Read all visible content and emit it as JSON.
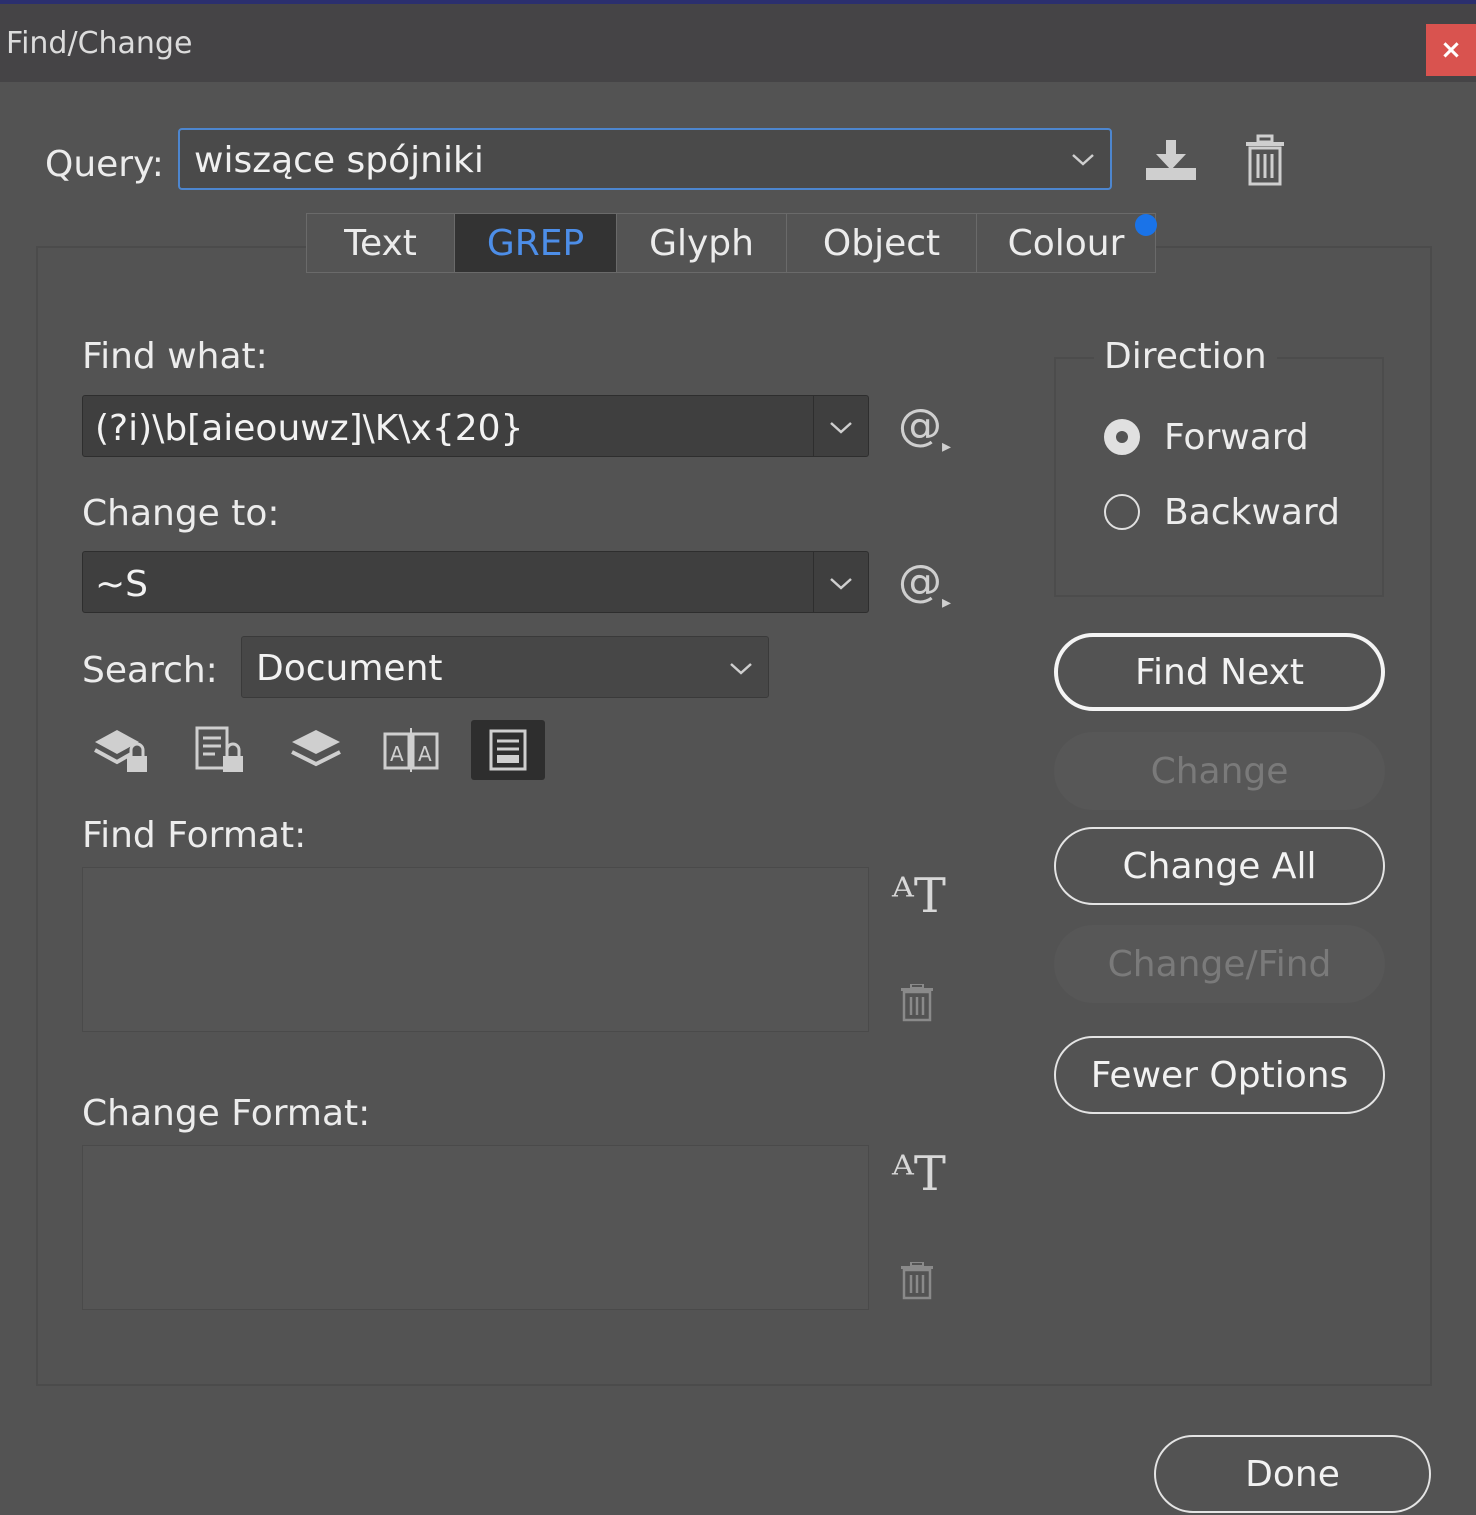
{
  "window": {
    "title": "Find/Change",
    "close_glyph": "×"
  },
  "query": {
    "label": "Query:",
    "value": "wiszące spójniki",
    "save_icon": "save-query-icon",
    "delete_icon": "delete-query-icon"
  },
  "tabs": [
    {
      "label": "Text",
      "active": false
    },
    {
      "label": "GREP",
      "active": true
    },
    {
      "label": "Glyph",
      "active": false
    },
    {
      "label": "Object",
      "active": false
    },
    {
      "label": "Colour",
      "active": false
    }
  ],
  "find_what": {
    "label": "Find what:",
    "value": "(?i)\\b[aieouwz]\\K\\x{20}",
    "special_glyph": "@"
  },
  "change_to": {
    "label": "Change to:",
    "value": "~S",
    "special_glyph": "@"
  },
  "search": {
    "label": "Search:",
    "value": "Document"
  },
  "options": [
    {
      "icon": "include-locked-layers-icon",
      "active": false
    },
    {
      "icon": "include-locked-stories-icon",
      "active": false
    },
    {
      "icon": "include-hidden-layers-icon",
      "active": false
    },
    {
      "icon": "include-master-pages-icon",
      "active": false
    },
    {
      "icon": "include-footnotes-icon",
      "active": true
    }
  ],
  "find_format": {
    "label": "Find Format:"
  },
  "change_format": {
    "label": "Change Format:"
  },
  "direction": {
    "title": "Direction",
    "options": [
      {
        "label": "Forward",
        "checked": true
      },
      {
        "label": "Backward",
        "checked": false
      }
    ]
  },
  "buttons": {
    "find_next": "Find Next",
    "change": "Change",
    "change_all": "Change All",
    "change_find": "Change/Find",
    "fewer_options": "Fewer Options",
    "done": "Done"
  },
  "colors": {
    "background": "#535353",
    "titlebar": "#454446",
    "active_tab_text": "#4d8ee8",
    "close": "#d9534f",
    "focus_border": "#4d86cf"
  }
}
